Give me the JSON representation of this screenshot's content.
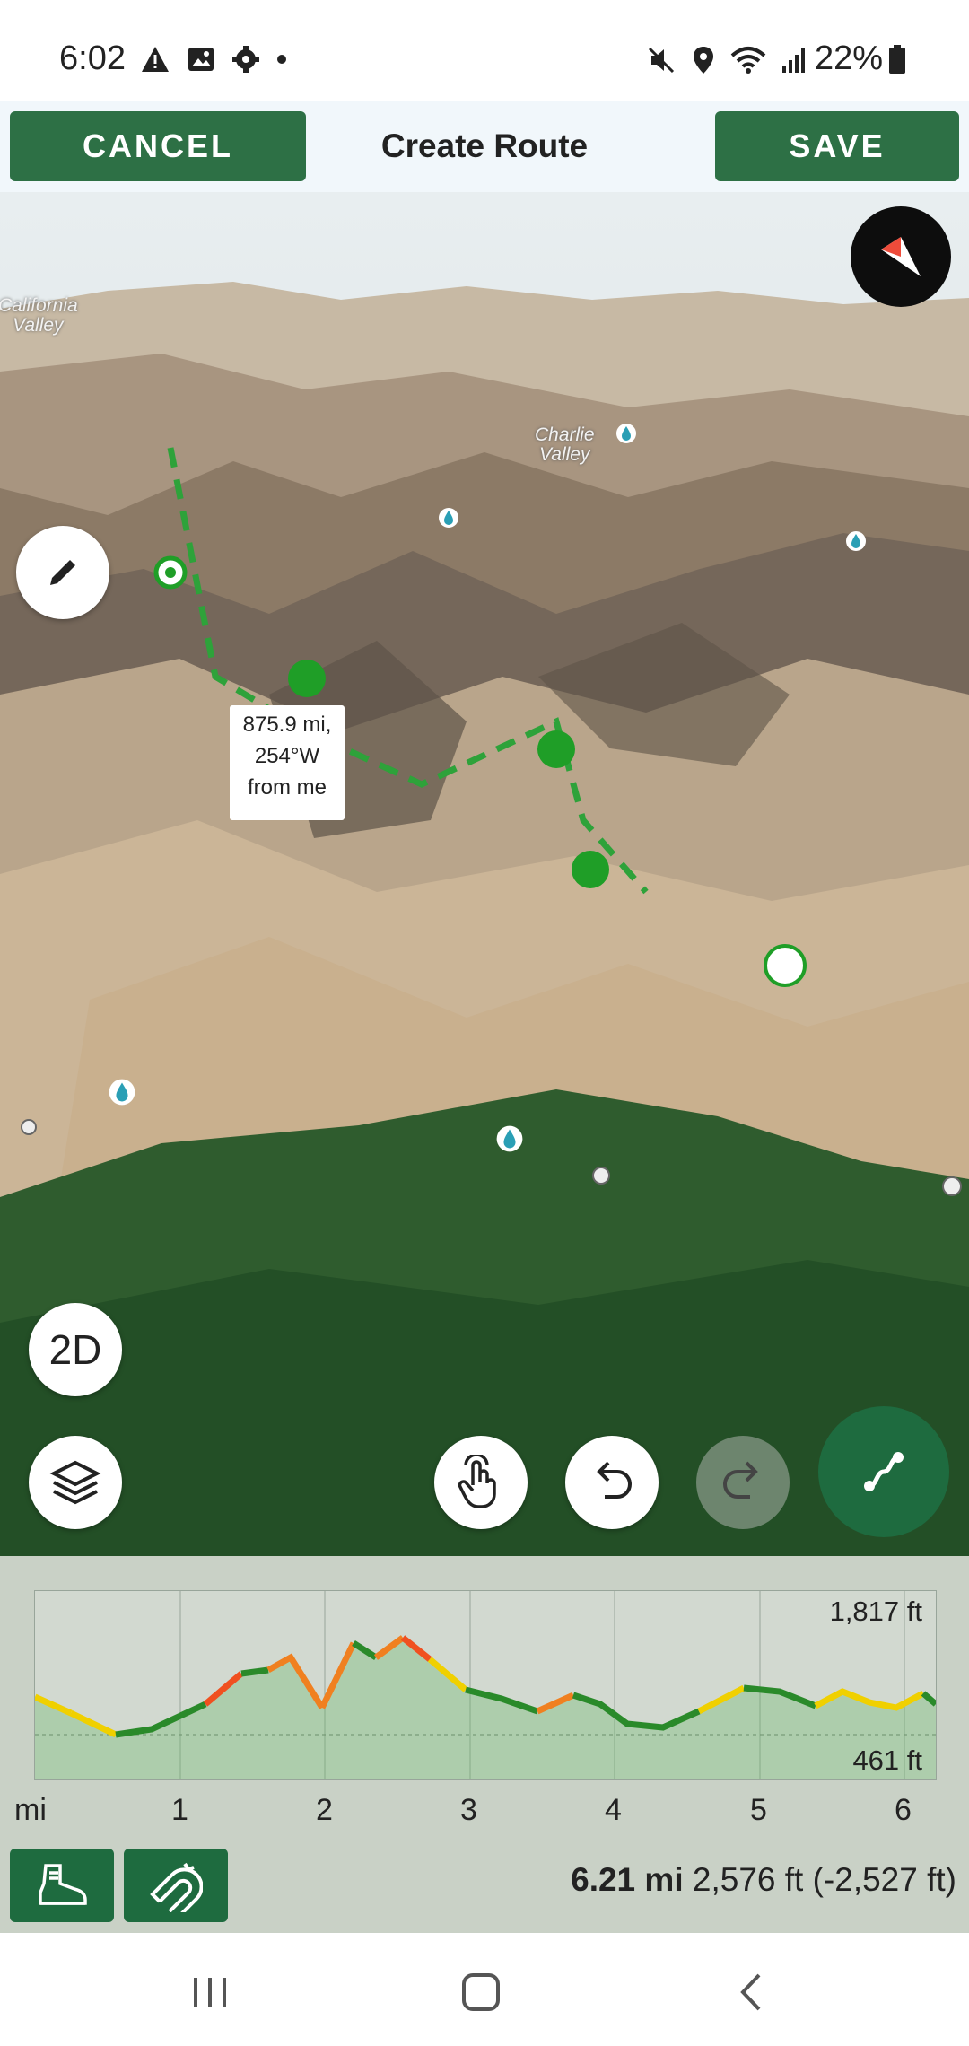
{
  "status_bar": {
    "time": "6:02",
    "battery": "22%",
    "left_icons": [
      "warning-icon",
      "image-icon",
      "settings-icon",
      "dot-icon"
    ],
    "right_icons": [
      "mute-icon",
      "location-icon",
      "wifi-icon",
      "signal-icon"
    ]
  },
  "header": {
    "cancel_label": "CANCEL",
    "title": "Create Route",
    "save_label": "SAVE",
    "accent_color": "#2d7045"
  },
  "map": {
    "place_labels": [
      "California\nValley",
      "Charlie\nValley"
    ],
    "tooltip_lines": [
      "875.9 mi,",
      "254°W",
      "from me"
    ],
    "view_toggle_label": "2D",
    "buttons": [
      "edit-icon",
      "compass-icon",
      "layers-icon",
      "tap-hand-icon",
      "undo-icon",
      "redo-icon",
      "draw-route-icon"
    ]
  },
  "elevation_profile": {
    "unit_label": "mi",
    "max_label": "1,817 ft",
    "min_label": "461 ft",
    "x_ticks": [
      "1",
      "2",
      "3",
      "4",
      "5",
      "6"
    ],
    "distance": "6.21 mi",
    "gain_loss": "2,576 ft (-2,527 ft)",
    "grade_colors": {
      "easy": "#2a8a2a",
      "moderate": "#f0d000",
      "steep": "#f08020",
      "very_steep": "#f05020"
    }
  },
  "bottom_buttons": [
    "hiking-boot-icon",
    "magnet-icon"
  ],
  "navbar": [
    "recent-apps-icon",
    "home-icon",
    "back-icon"
  ]
}
